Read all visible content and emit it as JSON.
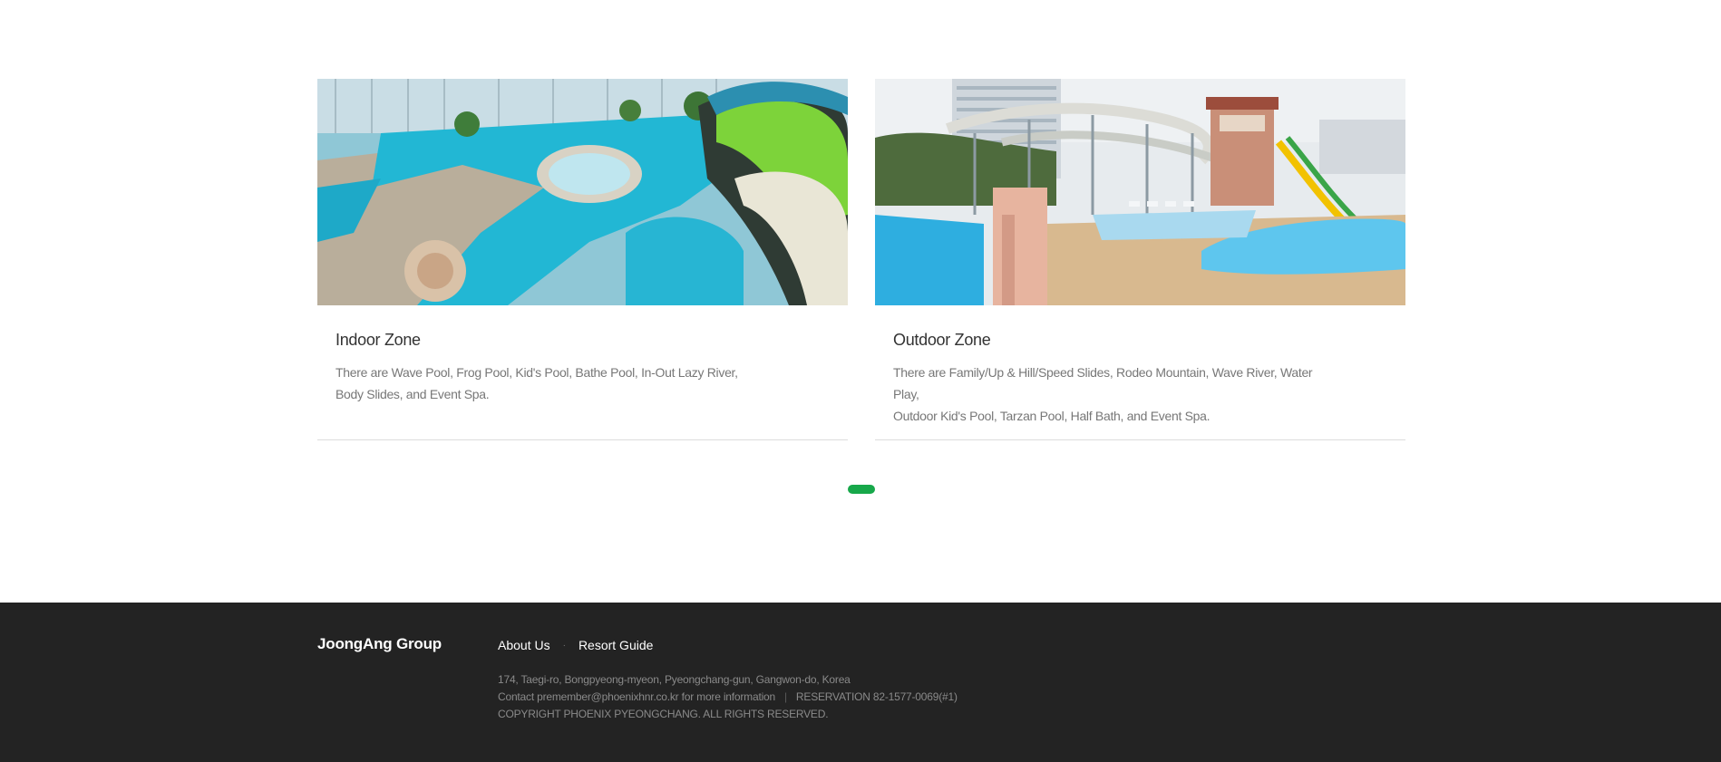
{
  "cards": [
    {
      "image_alt": "Indoor water park with pools and green water slide",
      "title": "Indoor Zone",
      "description_line1": "There are Wave Pool, Frog Pool, Kid's Pool, Bathe Pool, In-Out Lazy River,",
      "description_line2": "Body Slides, and Event Spa."
    },
    {
      "image_alt": "Outdoor water park with slides and pools",
      "title": "Outdoor Zone",
      "description_line1": "There are Family/Up & Hill/Speed Slides, Rodeo Mountain, Wave River, Water Play,",
      "description_line2": "Outdoor Kid's Pool, Tarzan Pool, Half Bath, and Event Spa."
    }
  ],
  "pager": {
    "active_color": "#17a84a",
    "pages": 1,
    "active": 1
  },
  "footer": {
    "logo": "JoongAng Group",
    "nav": [
      {
        "label": "About Us"
      },
      {
        "label": "Resort Guide"
      }
    ],
    "nav_separator": "·",
    "address": "174, Taegi-ro, Bongpyeong-myeon, Pyeongchang-gun, Gangwon-do, Korea",
    "contact": "Contact premember@phoenixhnr.co.kr for more information",
    "contact_separator": "|",
    "reservation": "RESERVATION 82-1577-0069(#1)",
    "copyright": "COPYRIGHT PHOENIX PYEONGCHANG. ALL RIGHTS RESERVED.",
    "background": "#232323"
  }
}
